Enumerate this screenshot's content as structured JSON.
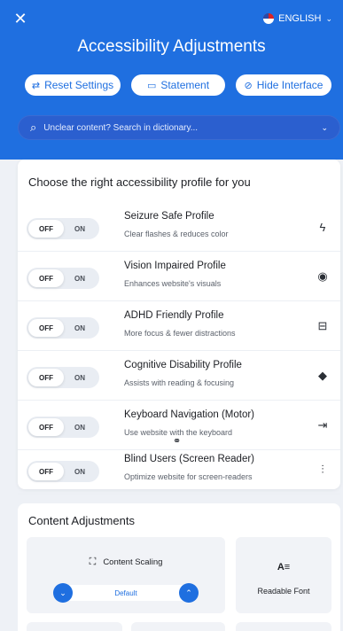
{
  "header": {
    "close_glyph": "✕",
    "language": "ENGLISH",
    "title": "Accessibility Adjustments",
    "buttons": [
      {
        "label": "Reset Settings",
        "icon": "reset-icon"
      },
      {
        "label": "Statement",
        "icon": "statement-icon"
      },
      {
        "label": "Hide Interface",
        "icon": "hide-icon"
      }
    ],
    "search": {
      "placeholder": "Unclear content? Search in dictionary..."
    }
  },
  "profiles": {
    "title": "Choose the right accessibility profile for you",
    "toggle_off": "OFF",
    "toggle_on": "ON",
    "items": [
      {
        "name": "Seizure Safe Profile",
        "description": "Clear flashes & reduces color",
        "icon": "bolt-icon",
        "glyph": "ϟ"
      },
      {
        "name": "Vision Impaired Profile",
        "description": "Enhances website's visuals",
        "icon": "eye-icon",
        "glyph": "◉"
      },
      {
        "name": "ADHD Friendly Profile",
        "description": "More focus & fewer distractions",
        "icon": "focus-icon",
        "glyph": "⊟"
      },
      {
        "name": "Cognitive Disability Profile",
        "description": "Assists with reading & focusing",
        "icon": "cognitive-icon",
        "glyph": "◆"
      },
      {
        "name": "Keyboard Navigation (Motor)",
        "description": "Use website with the keyboard",
        "icon": "keyboard-arrow-icon",
        "glyph": "⇥"
      },
      {
        "name": "Blind Users (Screen Reader)",
        "description": "Optimize website for screen-readers",
        "icon": "audio-icon",
        "glyph": "⫶"
      }
    ]
  },
  "content_adjustments": {
    "title": "Content Adjustments",
    "scaling": {
      "label": "Content Scaling",
      "value": "Default"
    },
    "readable_font": {
      "label": "Readable Font",
      "icon_text": "A≡"
    }
  },
  "colors": {
    "accent": "#1f6fe0",
    "background": "#eef1f6"
  }
}
